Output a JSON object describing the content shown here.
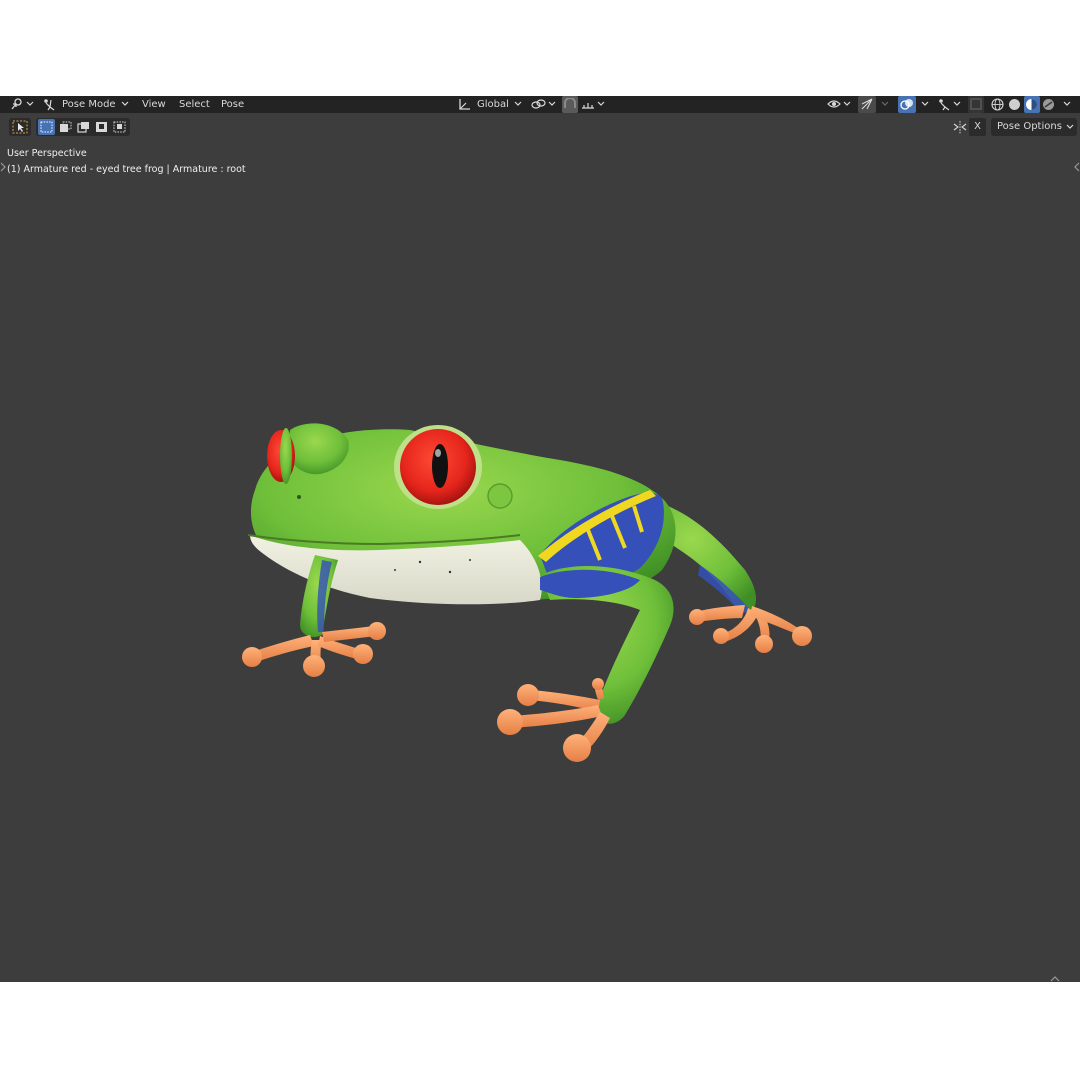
{
  "header": {
    "mode_label": "Pose Mode",
    "menus": [
      "View",
      "Select",
      "Pose"
    ],
    "orientation_label": "Global"
  },
  "toolbar": {
    "pose_options_label": "Pose Options",
    "close_glyph": "X"
  },
  "viewport": {
    "view_name": "User Perspective",
    "object_info": "(1) Armature red - eyed tree frog | Armature : root"
  },
  "icons": {
    "editor_type": "editor-type-icon",
    "mode": "pose-mode-icon",
    "transform": "transform-orientation-icon",
    "pivot": "pivot-link-icon",
    "snap": "snap-icon",
    "visibility": "visibility-eye-icon",
    "gizmo": "gizmo-icon",
    "overlays": "overlays-icon",
    "xray": "xray-icon",
    "shading": [
      "wireframe-shading-icon",
      "solid-shading-icon",
      "material-shading-icon",
      "rendered-shading-icon"
    ]
  },
  "colors": {
    "viewport_bg": "#3d3d3d",
    "header_bg": "#232323",
    "accent": "#4772b3",
    "frog_green": "#6fbf3a",
    "eye_red": "#e5251c",
    "toe_orange": "#f0975e",
    "flank_blue": "#3550b8"
  }
}
